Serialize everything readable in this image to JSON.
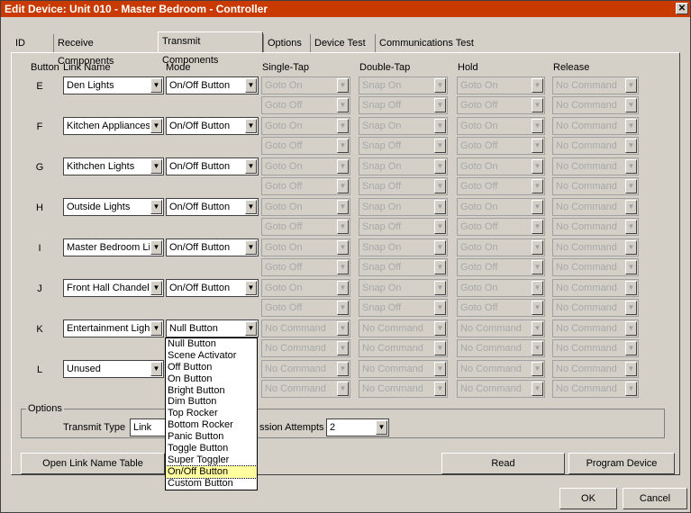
{
  "window": {
    "title": "Edit Device: Unit 010 - Master Bedroom - Controller",
    "close_glyph": "✕"
  },
  "tabs": [
    "ID",
    "Receive Components",
    "Transmit Components",
    "Options",
    "Device Test",
    "Communications Test"
  ],
  "active_tab": "Transmit Components",
  "headers": {
    "button": "Button",
    "link_name": "Link Name",
    "mode": "Mode",
    "single_tap": "Single-Tap",
    "double_tap": "Double-Tap",
    "hold": "Hold",
    "release": "Release"
  },
  "rows": [
    {
      "button": "E",
      "link": "Den Lights",
      "mode": "On/Off Button",
      "actions": [
        [
          "Goto On",
          "Snap On",
          "Goto On",
          "No Command"
        ],
        [
          "Goto Off",
          "Snap Off",
          "Goto Off",
          "No Command"
        ]
      ]
    },
    {
      "button": "F",
      "link": "Kitchen Appliances",
      "mode": "On/Off Button",
      "actions": [
        [
          "Goto On",
          "Snap On",
          "Goto On",
          "No Command"
        ],
        [
          "Goto Off",
          "Snap Off",
          "Goto Off",
          "No Command"
        ]
      ]
    },
    {
      "button": "G",
      "link": "Kithchen Lights",
      "mode": "On/Off Button",
      "actions": [
        [
          "Goto On",
          "Snap On",
          "Goto On",
          "No Command"
        ],
        [
          "Goto Off",
          "Snap Off",
          "Goto Off",
          "No Command"
        ]
      ]
    },
    {
      "button": "H",
      "link": "Outside Lights",
      "mode": "On/Off Button",
      "actions": [
        [
          "Goto On",
          "Snap On",
          "Goto On",
          "No Command"
        ],
        [
          "Goto Off",
          "Snap Off",
          "Goto Off",
          "No Command"
        ]
      ]
    },
    {
      "button": "I",
      "link": "Master Bedroom Lig",
      "mode": "On/Off Button",
      "actions": [
        [
          "Goto On",
          "Snap On",
          "Goto On",
          "No Command"
        ],
        [
          "Goto Off",
          "Snap Off",
          "Goto Off",
          "No Command"
        ]
      ]
    },
    {
      "button": "J",
      "link": "Front Hall Chandelie",
      "mode": "On/Off Button",
      "actions": [
        [
          "Goto On",
          "Snap On",
          "Goto On",
          "No Command"
        ],
        [
          "Goto Off",
          "Snap Off",
          "Goto Off",
          "No Command"
        ]
      ]
    },
    {
      "button": "K",
      "link": "Entertainment Lights",
      "mode": "Null Button",
      "actions": [
        [
          "No Command",
          "No Command",
          "No Command",
          "No Command"
        ],
        [
          "No Command",
          "No Command",
          "No Command",
          "No Command"
        ]
      ]
    },
    {
      "button": "L",
      "link": "Unused",
      "mode": "",
      "actions": [
        [
          "No Command",
          "No Command",
          "No Command",
          "No Command"
        ],
        [
          "No Command",
          "No Command",
          "No Command",
          "No Command"
        ]
      ]
    }
  ],
  "mode_dropdown": {
    "options": [
      "Null Button",
      "Scene Activator",
      "Off Button",
      "On Button",
      "Bright Button",
      "Dim Button",
      "Top Rocker",
      "Bottom Rocker",
      "Panic Button",
      "Toggle Button",
      "Super Toggler",
      "On/Off Button",
      "Custom Button"
    ],
    "highlighted": "On/Off Button"
  },
  "options_group": {
    "label": "Options",
    "transmit_type_label": "Transmit Type",
    "transmit_type_value": "Link Pa",
    "attempts_label": "ssion Attempts",
    "attempts_value": "2"
  },
  "buttons": {
    "open_link_name_table": "Open Link Name Table",
    "read": "Read",
    "program_device": "Program Device",
    "ok": "OK",
    "cancel": "Cancel"
  },
  "arrow_glyph": "▼"
}
